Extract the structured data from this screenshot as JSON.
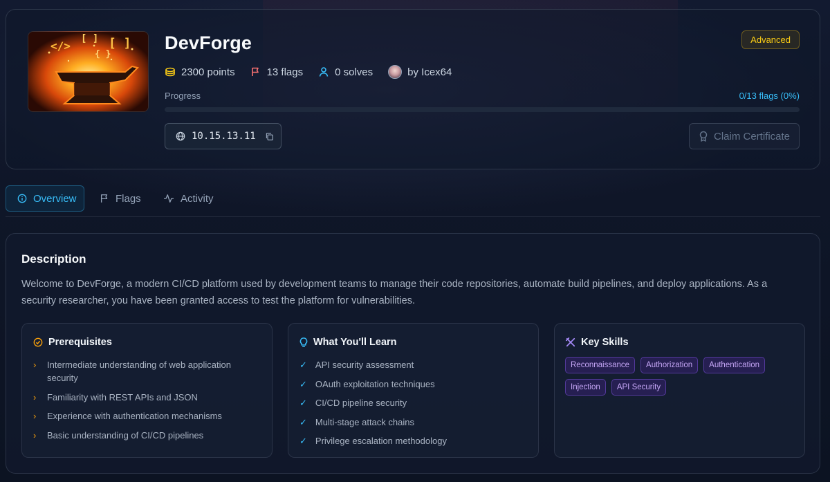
{
  "challenge": {
    "title": "DevForge",
    "difficulty": "Advanced",
    "points": "2300 points",
    "flags": "13 flags",
    "solves": "0 solves",
    "author": "by Icex64",
    "progress_label": "Progress",
    "progress_text": "0/13 flags (0%)",
    "progress_fraction": 0,
    "ip_address": "10.15.13.11",
    "claim_label": "Claim Certificate",
    "thumbnail_glyphs": [
      "</>",
      "[ ]",
      "[ ]",
      "{ }"
    ]
  },
  "tabs": [
    {
      "label": "Overview",
      "icon": "info-icon",
      "active": true
    },
    {
      "label": "Flags",
      "icon": "flag-icon",
      "active": false
    },
    {
      "label": "Activity",
      "icon": "activity-icon",
      "active": false
    }
  ],
  "overview": {
    "description_title": "Description",
    "description": "Welcome to DevForge, a modern CI/CD platform used by development teams to manage their code repositories, automate build pipelines, and deploy applications. As a security researcher, you have been granted access to test the platform for vulnerabilities.",
    "prerequisites": {
      "title": "Prerequisites",
      "icon": "check-circle-icon",
      "items": [
        "Intermediate understanding of web application security",
        "Familiarity with REST APIs and JSON",
        "Experience with authentication mechanisms",
        "Basic understanding of CI/CD pipelines"
      ]
    },
    "learn": {
      "title": "What You'll Learn",
      "icon": "lightbulb-icon",
      "items": [
        "API security assessment",
        "OAuth exploitation techniques",
        "CI/CD pipeline security",
        "Multi-stage attack chains",
        "Privilege escalation methodology"
      ]
    },
    "skills": {
      "title": "Key Skills",
      "icon": "tools-icon",
      "items": [
        "Reconnaissance",
        "Authorization",
        "Authentication",
        "Injection",
        "API Security"
      ]
    }
  },
  "colors": {
    "accent": "#38bdf8",
    "difficulty": "#facc15",
    "prereq_bullet": "#f59e0b",
    "learn_check": "#38bdf8",
    "skill": "#c4a5f5"
  }
}
